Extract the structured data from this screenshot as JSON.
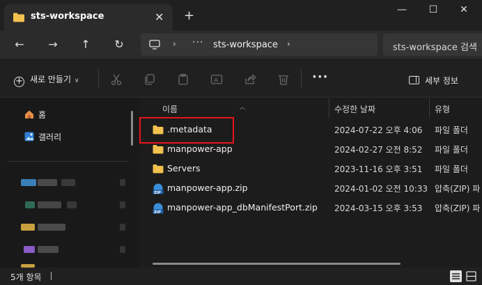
{
  "window": {
    "tab_title": "sts-workspace",
    "tab_close": "✕",
    "new_tab": "+",
    "minimize": "—",
    "maximize": "☐",
    "close": "✕"
  },
  "navigation": {
    "back": "←",
    "forward": "→",
    "up": "↑",
    "refresh": "↻"
  },
  "address": {
    "overflow": "···",
    "crumb": "sts-workspace",
    "separator": "›"
  },
  "search": {
    "placeholder": "sts-workspace 검색"
  },
  "commandbar": {
    "new_label": "새로 만들기",
    "more": "···",
    "details_label": "세부 정보",
    "icons": [
      "cut-icon",
      "copy-icon",
      "paste-icon",
      "rename-icon",
      "share-icon",
      "delete-icon"
    ]
  },
  "sidebar": {
    "items": [
      {
        "label": "홈",
        "icon": "home-icon"
      },
      {
        "label": "갤러리",
        "icon": "gallery-icon"
      }
    ]
  },
  "columns": {
    "name": "이름",
    "modified": "수정한 날짜",
    "type": "유형"
  },
  "files": [
    {
      "name": ".metadata",
      "modified": "2024-07-22 오후 4:06",
      "type": "파일 폴더",
      "icon": "folder-icon"
    },
    {
      "name": "manpower-app",
      "modified": "2024-02-27 오전 8:52",
      "type": "파일 폴더",
      "icon": "folder-icon"
    },
    {
      "name": "Servers",
      "modified": "2023-11-16 오후 3:51",
      "type": "파일 폴더",
      "icon": "folder-icon"
    },
    {
      "name": "manpower-app.zip",
      "modified": "2024-01-02 오전 10:33",
      "type": "압축(ZIP) 파",
      "icon": "zip-icon"
    },
    {
      "name": "manpower-app_dbManifestPort.zip",
      "modified": "2024-03-15 오후 3:53",
      "type": "압축(ZIP) 파",
      "icon": "zip-icon"
    }
  ],
  "status": {
    "item_count": "5개 항목"
  },
  "colors": {
    "background": "#1c1c1c",
    "folder": "#f2c14e",
    "zip_blue": "#3b8fd9",
    "highlight_red": "#e8141c"
  }
}
